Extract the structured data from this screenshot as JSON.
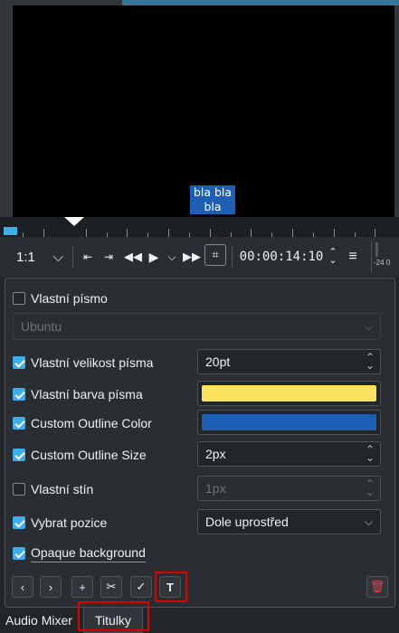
{
  "monitor": {
    "subtitle_line1": "bla bla",
    "subtitle_line2": "bla"
  },
  "transport": {
    "zoom_value": "1:1",
    "timecode": "00:00:14:10",
    "meter_label": "-24 0"
  },
  "panel": {
    "custom_font": {
      "label": "Vlastní písmo",
      "checked": false
    },
    "font_combo": {
      "value": "Ubuntu",
      "disabled": true
    },
    "custom_font_size": {
      "label": "Vlastní velikost písma",
      "checked": true,
      "value": "20pt"
    },
    "custom_font_color": {
      "label": "Vlastní barva písma",
      "checked": true,
      "color": "#f9e25d"
    },
    "custom_outline_color": {
      "label": "Custom Outline Color",
      "checked": true,
      "color": "#1d5fb4"
    },
    "custom_outline_size": {
      "label": "Custom Outline Size",
      "checked": true,
      "value": "2px"
    },
    "custom_shadow": {
      "label": "Vlastní stín",
      "checked": false,
      "value": "1px"
    },
    "select_position": {
      "label": "Vybrat pozice",
      "checked": true,
      "value": "Dole uprostřed"
    },
    "opaque_background": {
      "label": "Opaque background",
      "checked": true
    }
  },
  "actions": {
    "prev_icon": "chevron-left-icon",
    "next_icon": "chevron-right-icon",
    "add_icon": "plus-icon",
    "cut_icon": "scissors-icon",
    "apply_icon": "check-icon",
    "text_icon": "text-tool-icon",
    "delete_icon": "trash-icon",
    "highlight_color": "#e00000"
  },
  "tabs": {
    "audio_mixer": "Audio Mixer",
    "subtitles": "Titulky"
  },
  "colors": {
    "accent": "#3daee9",
    "background": "#232629",
    "subtitle_bg": "#1d5fb4"
  }
}
